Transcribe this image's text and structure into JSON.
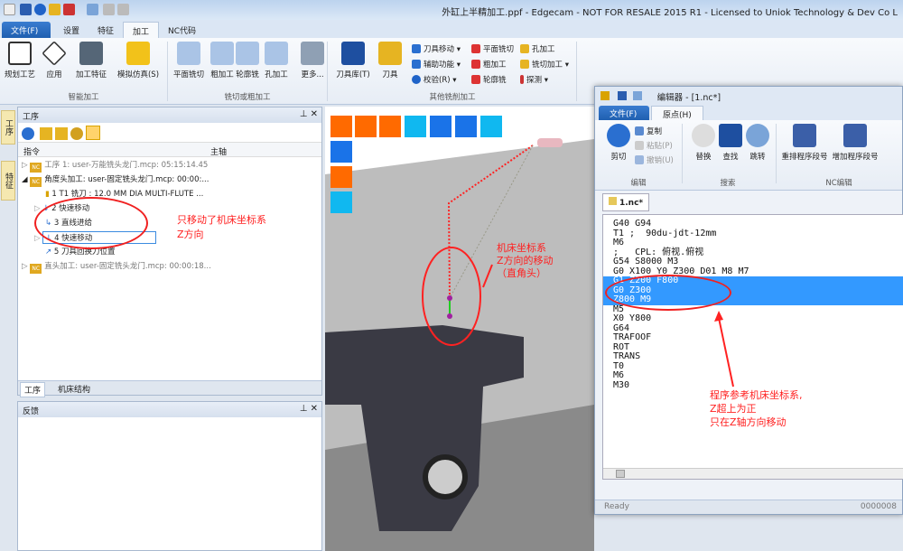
{
  "window": {
    "title": "外缸上半精加工.ppf - Edgecam - NOT FOR RESALE 2015 R1  - Licensed to Uniok Technology & Dev Co L"
  },
  "tabs": [
    "文件(F)",
    "设置",
    "特征",
    "加工",
    "NC代码"
  ],
  "ribbon": {
    "big": [
      "规划工艺",
      "应用",
      "加工特征",
      "模拟仿真(S)",
      "平面铣切",
      "粗加工",
      "轮廓铣",
      "孔加工",
      "更多...",
      "刀具库(T)",
      "刀具"
    ],
    "small": [
      "刀具移动",
      "辅助功能",
      "校验(R)",
      "平面铣切",
      "粗加工",
      "轮廓铣",
      "孔加工",
      "铣切加工",
      "探测"
    ],
    "groups": [
      "智能加工",
      "铣切或粗加工",
      "其他铣削加工"
    ]
  },
  "left_strip": [
    "工序",
    "特征"
  ],
  "process_panel": {
    "title": "工序",
    "columns": [
      "指令",
      "主轴"
    ],
    "rows": [
      "工序 1: user-万能铣头龙门.mcp: 05:15:14.45",
      "角度头加工: user-固定铣头龙门.mcp: 00:00:...",
      "1 T1 铣刀 : 12.0 MM DIA MULTI-FLUTE ...",
      "2 快速移动",
      "3 直线进给",
      "4 快速移动",
      "5 刀具回换刀位置",
      "直头加工: user-固定铣头龙门.mcp: 00:00:18..."
    ],
    "tabs": [
      "工序",
      "机床结构"
    ],
    "annotation": [
      "只移动了机床坐标系",
      "Z方向"
    ]
  },
  "feedback_panel": {
    "title": "反馈"
  },
  "viewport": {
    "annotation": [
      "机床坐标系",
      "Z方向的移动",
      "（直角头）"
    ]
  },
  "editor": {
    "title": "编辑器 - [1.nc*]",
    "tabs": [
      "文件(F)",
      "原点(H)"
    ],
    "buttons": {
      "cut": "剪切",
      "copy": "复制",
      "paste": "粘贴(P)",
      "undo": "撤销(U)",
      "replace": "替换",
      "find": "查找",
      "goto": "跳转",
      "renumber": "重排程序段号",
      "addnum": "增加程序段号"
    },
    "groups": [
      "编辑",
      "搜索",
      "NC编辑"
    ],
    "doc_tab": "1.nc*",
    "lines": [
      "G40 G94",
      "T1 ;  90du-jdt-12mm",
      "M6",
      ";   CPL: 俯视.俯视",
      "G54 S8000 M3",
      "G0 X100 Y0 Z300 D01 M8 M7",
      "G1 Z200 F800",
      "G0 Z300",
      "Z800 M9",
      "M5",
      "X0 Y800",
      "G64",
      "TRAFOOF",
      "ROT",
      "TRANS",
      "T0",
      "M6",
      "M30"
    ],
    "selected_lines": [
      6,
      7,
      8
    ],
    "annotation": [
      "程序参考机床坐标系,",
      "Z超上为正",
      "只在Z轴方向移动"
    ],
    "status": "Ready",
    "status_right": "0000008"
  },
  "colors": {
    "annotation": "#ff2020",
    "selection": "#3399ff",
    "orange": "#ff6a00",
    "blue": "#1a73e8",
    "cyan": "#10b8f0"
  }
}
